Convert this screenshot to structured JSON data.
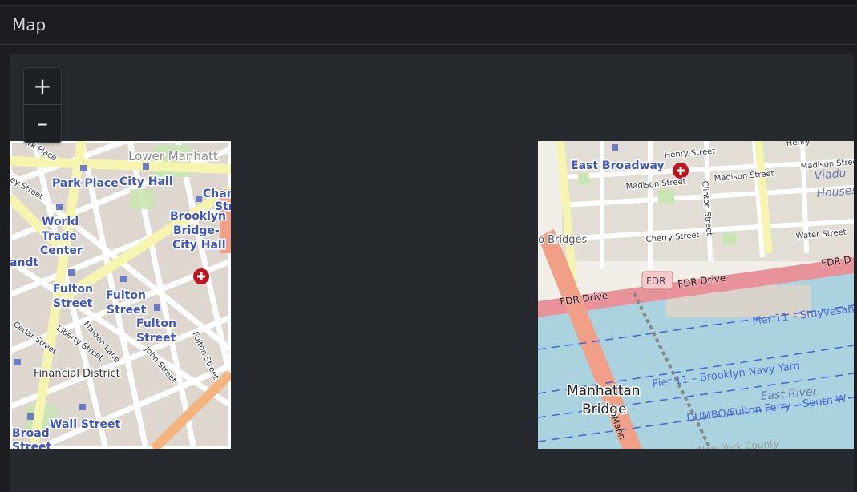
{
  "panel": {
    "title": "Map"
  },
  "zoom": {
    "in_label": "+",
    "out_label": "–"
  },
  "colors": {
    "map_bg": "#262a2e",
    "land": "#f2efe9",
    "block": "#e0dcd5",
    "major_road": "#f6f5b0",
    "highway": "#f29f87",
    "water": "#aad3df",
    "label_blue": "#3e56c2",
    "poi_red": "#c1121f"
  },
  "tile_left": {
    "labels": {
      "park_place": "Park Place",
      "city_hall": "City Hall",
      "lower_manhattan": "Lower Manhatt",
      "brooklyn_1": "Brooklyn",
      "brooklyn_2": "Bridge-",
      "brooklyn_3": "City Hall",
      "world_1": "World",
      "world_2": "Trade",
      "world_3": "Center",
      "landt": "andt",
      "fulton_a1": "Fulton",
      "fulton_a2": "Street",
      "fulton_b1": "Fulton",
      "fulton_b2": "Street",
      "fulton_c1": "Fulton",
      "fulton_c2": "Street",
      "financial_district": "Financial District",
      "wall_street": "Wall Street",
      "broad": "Broad",
      "broad_2": "Street",
      "cedar_street": "Cedar Street",
      "liberty_street": "Liberty Street",
      "maiden_lane": "Maiden Lane",
      "john_street": "John Street",
      "fulton_street_road": "Fulton Street",
      "rk_place": "rk Place",
      "ey_street": "ey Street",
      "chan_1": "Chan",
      "chan_2": "Str"
    }
  },
  "tile_right": {
    "labels": {
      "east_broadway": "East Broadway",
      "henry_street": "Henry Street",
      "madison_1": "Madison Street",
      "madison_2": "Madison Street",
      "madison_3": "Madison Street",
      "clinton_street": "Clinton Street",
      "cherry_street": "Cherry Street",
      "water_street": "Water Street",
      "o_bridges": "o Bridges",
      "fdr_drive_1": "FDR Drive",
      "fdr_drive_2": "FDR Drive",
      "fdr_drive_3": "FDR D",
      "fdr_shield": "FDR",
      "pier_11_stuy": "Pier 11 – Stuyvesan",
      "pier_11_navy": "Pier 11 – Brooklyn Navy Yard",
      "east_river": "East River",
      "dumbo": "DUMBO/Fulton Ferry – South W",
      "manhattan_bridge_1": "Manhattan",
      "manhattan_bridge_2": "Bridge",
      "manh": "Manh",
      "viaduct_1": "Viadu",
      "viaduct_2": "Houses",
      "henry_2": "Henry",
      "york_county": "New York County"
    }
  }
}
